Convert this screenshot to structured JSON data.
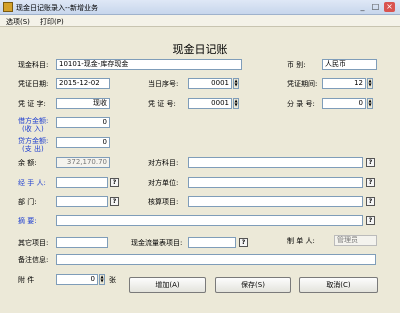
{
  "window": {
    "title": "现金日记账录入--新增业务",
    "minimize": "_",
    "maximize": "□",
    "close": "×"
  },
  "menu": {
    "items": [
      {
        "label": "选项(S)"
      },
      {
        "label": "打印(P)"
      }
    ]
  },
  "form": {
    "title": "现金日记账",
    "cash_account": {
      "label": "现金科目:",
      "value": "10101-现金-库存现金"
    },
    "currency": {
      "label": "币    别:",
      "value": "人民币"
    },
    "voucher_date": {
      "label": "凭证日期:",
      "value": "2015-12-02"
    },
    "daily_seq": {
      "label": "当日序号:",
      "value": "0001"
    },
    "voucher_period": {
      "label": "凭证期间:",
      "value": "12"
    },
    "voucher_word": {
      "label": "凭 证 字:",
      "value": "现收"
    },
    "voucher_no": {
      "label": "凭 证 号:",
      "value": "0001"
    },
    "entry_no": {
      "label": "分 录 号:",
      "value": "0"
    },
    "debit_amount": {
      "label1": "借方金额:",
      "label2": "(收  入)",
      "value": "0"
    },
    "credit_amount": {
      "label1": "贷方金额:",
      "label2": "(支  出)",
      "value": "0"
    },
    "balance": {
      "label": "余    额:",
      "value": "372,170.70"
    },
    "contra_account": {
      "label": "对方科目:",
      "value": ""
    },
    "handler": {
      "label": "经 手 人:",
      "value": ""
    },
    "contra_unit": {
      "label": "对方单位:",
      "value": ""
    },
    "department": {
      "label": "部    门:",
      "value": ""
    },
    "accounting_item": {
      "label": "核算项目:",
      "value": ""
    },
    "summary": {
      "label": "摘    要:",
      "value": ""
    },
    "other_item": {
      "label": "其它项目:",
      "value": ""
    },
    "cashflow_item": {
      "label": "现金流量表项目:",
      "value": ""
    },
    "preparer": {
      "label": "制 单 人:",
      "value": "管理员"
    },
    "remarks": {
      "label": "备注信息:",
      "value": ""
    },
    "attachments": {
      "label": "附    件",
      "value": "0",
      "unit": "张"
    },
    "spin_up": "▲",
    "spin_down": "▼",
    "lookup_glyph": "?"
  },
  "buttons": {
    "add": "增加(A)",
    "save": "保存(S)",
    "cancel": "取消(C)"
  },
  "colors": {
    "blue_label": "#1f3fd0",
    "background": "#ece9d8"
  }
}
